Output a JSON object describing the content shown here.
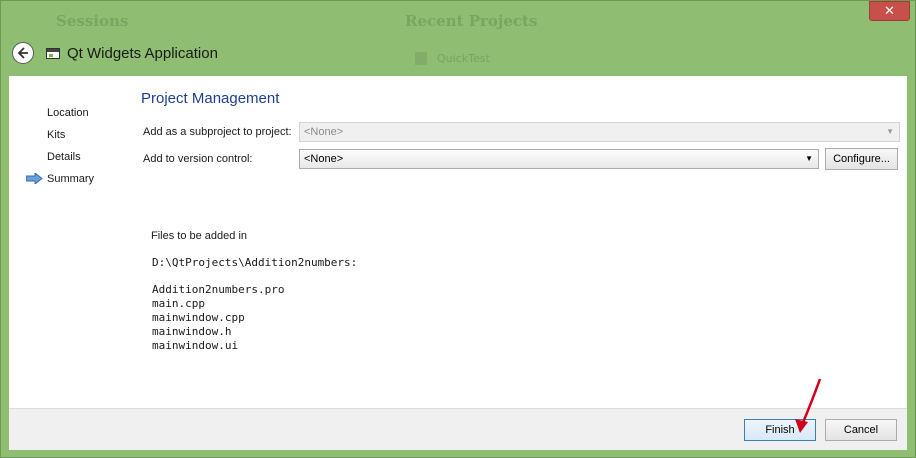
{
  "background": {
    "sessions_title": "Sessions",
    "recent_projects_title": "Recent Projects",
    "recent_item": "QuickTest"
  },
  "window": {
    "title": "Qt Widgets Application",
    "close_symbol": "✕"
  },
  "sidebar": {
    "items": [
      {
        "label": "Location"
      },
      {
        "label": "Kits"
      },
      {
        "label": "Details"
      },
      {
        "label": "Summary",
        "current": true
      }
    ]
  },
  "main": {
    "section_title": "Project Management",
    "subproject_label": "Add as a subproject to project:",
    "subproject_value": "<None>",
    "version_control_label": "Add to version control:",
    "version_control_value": "<None>",
    "configure_label": "Configure...",
    "files_heading": "Files to be added in",
    "files_path": "D:\\QtProjects\\Addition2numbers:",
    "files": [
      "Addition2numbers.pro",
      "main.cpp",
      "mainwindow.cpp",
      "mainwindow.h",
      "mainwindow.ui"
    ]
  },
  "footer": {
    "finish_label": "Finish",
    "cancel_label": "Cancel"
  },
  "colors": {
    "desktop_bg": "#8fbd72",
    "section_title": "#1e3f8a",
    "close_button": "#c7504b",
    "annotation_arrow": "#d0021b"
  }
}
